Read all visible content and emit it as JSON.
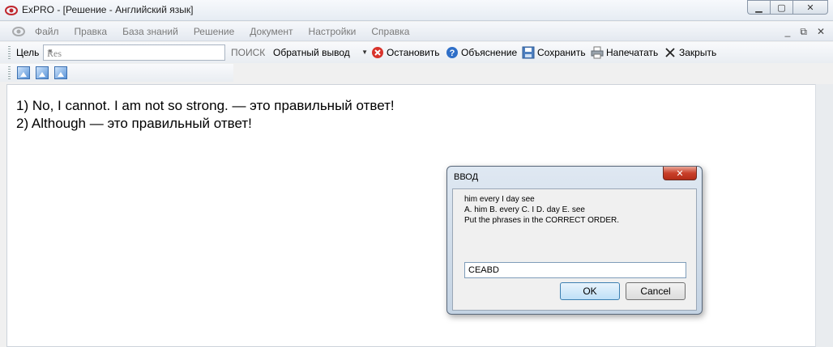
{
  "window": {
    "title": "ExPRO - [Решение - Английский язык]",
    "controls": {
      "minimize": "minimize-icon",
      "maximize": "maximize-icon",
      "close": "close-icon"
    }
  },
  "menu": {
    "items": [
      "Файл",
      "Правка",
      "База знаний",
      "Решение",
      "Документ",
      "Настройки",
      "Справка"
    ]
  },
  "toolbar": {
    "goal_label": "Цель",
    "goal_value": "Res",
    "search_label": "ПОИСК",
    "search_mode": "Обратный вывод",
    "stop_label": "Остановить",
    "explain_label": "Объяснение",
    "save_label": "Сохранить",
    "print_label": "Напечатать",
    "close_label": "Закрыть"
  },
  "content": {
    "lines": [
      "1) No, I cannot. I am not so strong. — это правильный ответ!",
      "2) Although — это правильный ответ!"
    ]
  },
  "dialog": {
    "title": "ВВОД",
    "lines": [
      "him every I day see",
      "A. him B. every C. I D. day E. see",
      "Put the phrases in the CORRECT ORDER."
    ],
    "input_value": "CEABD",
    "ok_label": "OK",
    "cancel_label": "Cancel"
  }
}
